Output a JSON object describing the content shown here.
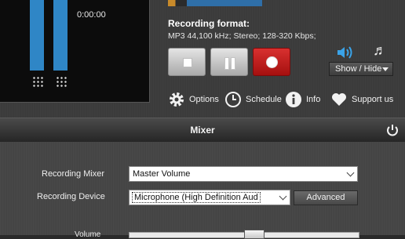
{
  "recorder": {
    "time": "0:00:00",
    "level_left": 1.0,
    "level_right": 1.0
  },
  "format": {
    "title": "Recording format:",
    "description": "MP3 44,100 kHz; Stereo;  128-320 Kbps;"
  },
  "controls": {
    "stop_icon": "stop-icon",
    "pause_icon": "pause-icon",
    "record_icon": "record-icon"
  },
  "side": {
    "show_hide_label": "Show / Hide",
    "speaker_icon": "speaker-icon",
    "note_icon": "music-note-icon"
  },
  "links": {
    "options": "Options",
    "schedule": "Schedule",
    "info": "Info",
    "support": "Support us"
  },
  "mixer": {
    "title": "Mixer",
    "recording_mixer_label": "Recording Mixer",
    "recording_mixer_value": "Master Volume",
    "recording_device_label": "Recording Device",
    "recording_device_value": "Microphone (High Definition Aud",
    "advanced_label": "Advanced",
    "volume_label": "Volume",
    "volume_level": 0.55
  },
  "colors": {
    "accent_blue": "#2f86c6",
    "record_red": "#c01f1e"
  }
}
